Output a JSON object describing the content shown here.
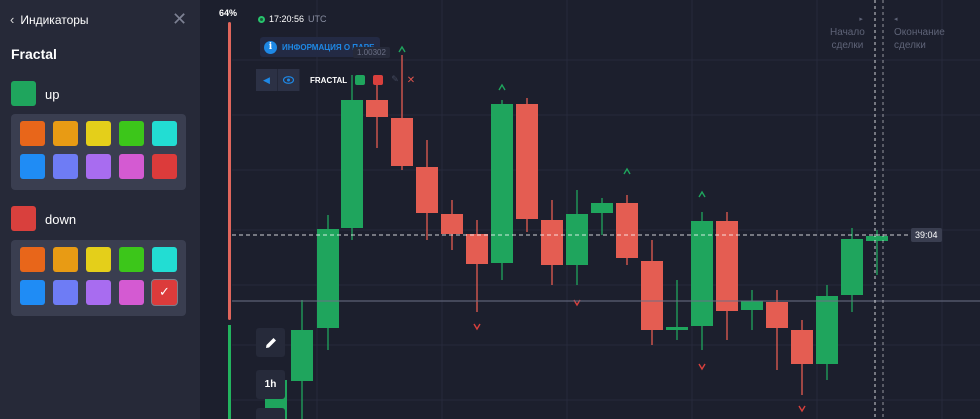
{
  "panel": {
    "back_label": "Индикаторы",
    "indicator_name": "Fractal",
    "up": {
      "label": "up",
      "color": "#1fa55d"
    },
    "down": {
      "label": "down",
      "color": "#d9403d"
    },
    "palette_colors": [
      "#e8661a",
      "#e89b14",
      "#e4cf1a",
      "#3cc61a",
      "#22ddd3",
      "#1f8cf5",
      "#6e7cf5",
      "#a86cf0",
      "#d45ad2",
      "#dc3b3b"
    ],
    "up_selected_index": -1,
    "down_selected_index": 9,
    "check_glyph": "✓"
  },
  "sentiment": {
    "percent": "64%",
    "value": 64
  },
  "header": {
    "clock": "17:20:56",
    "timezone": "UTC",
    "info_button": "ИНФОРМАЦИЯ О ПАРЕ",
    "price_tooltip": "1.00302"
  },
  "indicator_bar": {
    "name": "FRACTAL",
    "up_color": "#1fa55d",
    "down_color": "#d9403d",
    "icons": [
      "collapse-icon",
      "eye-icon",
      "pencil-icon",
      "close-icon"
    ]
  },
  "deal": {
    "start_line1": "Начало",
    "start_line2": "сделки",
    "end_line1": "Окончание",
    "end_line2": "сделки"
  },
  "timer": "39:04",
  "timeframe": "1h",
  "colors": {
    "bull": "#1fa55d",
    "bear": "#e45d52",
    "fractal_up": "#1fa55d",
    "fractal_down": "#d9403d",
    "grid": "#262a3b",
    "background": "#1c1f2d"
  }
}
